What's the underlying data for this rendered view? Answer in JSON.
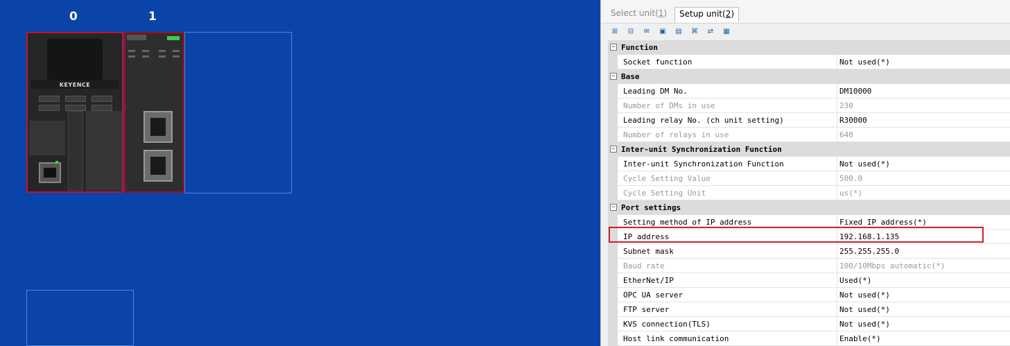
{
  "canvas": {
    "slots": [
      "0",
      "1"
    ],
    "cpu_brand": "KEYENCE"
  },
  "tabs": [
    {
      "label": "Select unit(",
      "key": "1",
      "suffix": ")"
    },
    {
      "label": "Setup unit(",
      "key": "2",
      "suffix": ")"
    }
  ],
  "sections": [
    {
      "title": "Function",
      "rows": [
        {
          "name": "Socket function",
          "value": "Not used(*)",
          "disabled": false
        }
      ]
    },
    {
      "title": "Base",
      "rows": [
        {
          "name": "Leading DM No.",
          "value": "DM10000",
          "disabled": false
        },
        {
          "name": "Number of DMs in use",
          "value": "230",
          "disabled": true
        },
        {
          "name": "Leading relay No. (ch unit setting)",
          "value": "R30000",
          "disabled": false
        },
        {
          "name": "Number of relays in use",
          "value": "640",
          "disabled": true
        }
      ]
    },
    {
      "title": "Inter-unit Synchronization Function",
      "rows": [
        {
          "name": "Inter-unit Synchronization Function",
          "value": "Not used(*)",
          "disabled": false
        },
        {
          "name": "Cycle Setting Value",
          "value": "500.0",
          "disabled": true
        },
        {
          "name": "Cycle Setting Unit",
          "value": "us(*)",
          "disabled": true
        }
      ]
    },
    {
      "title": "Port settings",
      "rows": [
        {
          "name": "Setting method of IP address",
          "value": "Fixed IP address(*)",
          "disabled": false
        },
        {
          "name": "IP address",
          "value": "192.168.1.135",
          "disabled": false
        },
        {
          "name": "Subnet mask",
          "value": "255.255.255.0",
          "disabled": false
        },
        {
          "name": "Baud rate",
          "value": "100/10Mbps automatic(*)",
          "disabled": true
        },
        {
          "name": "EtherNet/IP",
          "value": "Used(*)",
          "disabled": false
        },
        {
          "name": "OPC UA server",
          "value": "Not used(*)",
          "disabled": false
        },
        {
          "name": "FTP server",
          "value": "Not used(*)",
          "disabled": false
        },
        {
          "name": "KVS connection(TLS)",
          "value": "Not used(*)",
          "disabled": false
        },
        {
          "name": "Host link communication",
          "value": "Enable(*)",
          "disabled": false
        }
      ]
    }
  ],
  "colors": {
    "canvas_bg": "#0a44a8",
    "highlight": "#d0202a"
  }
}
